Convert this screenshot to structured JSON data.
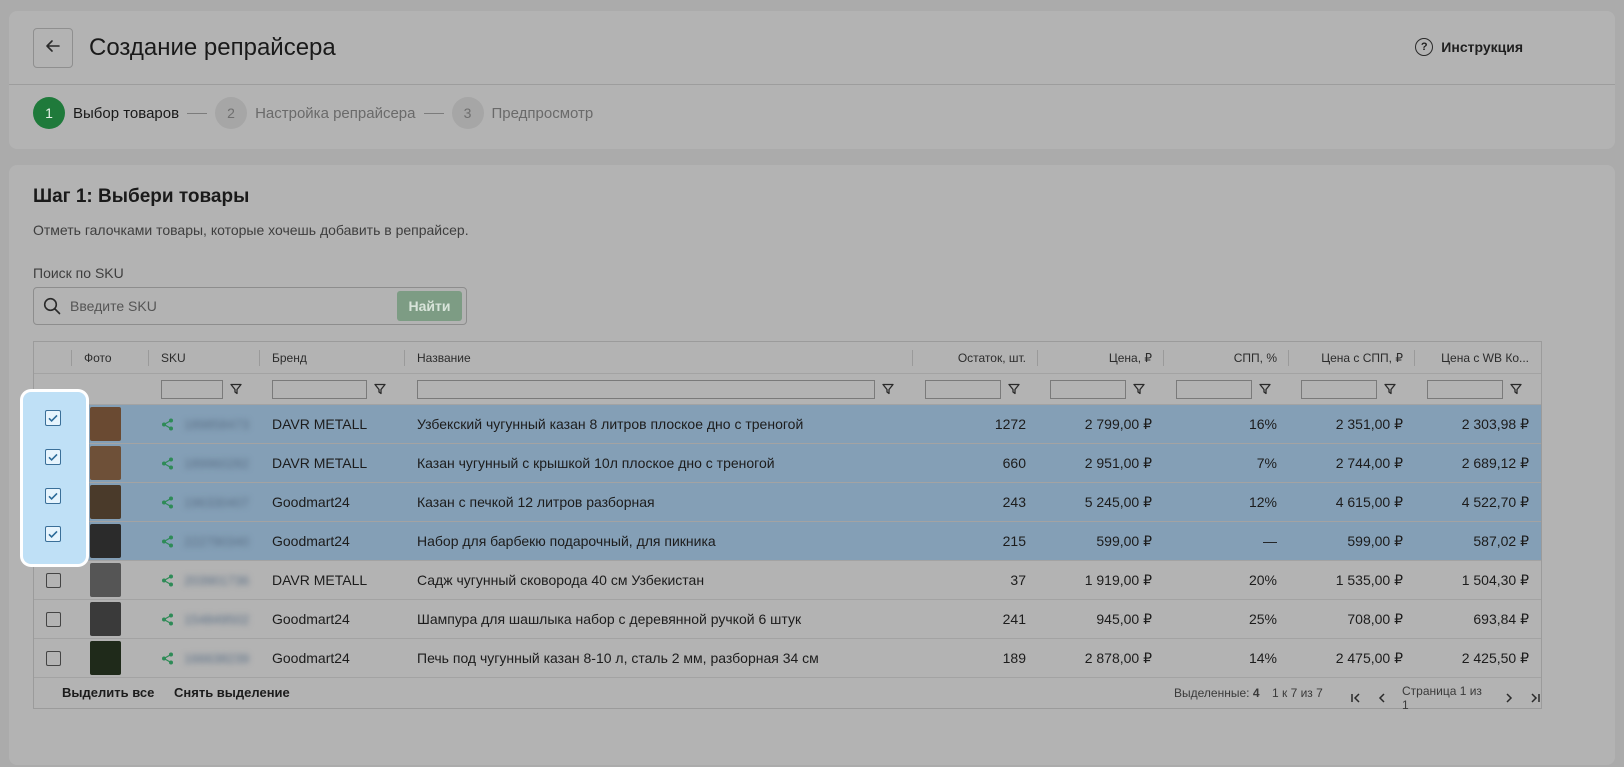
{
  "header": {
    "title": "Создание репрайсера",
    "instruction_label": "Инструкция",
    "instruction_icon": "?"
  },
  "steps": [
    {
      "num": "1",
      "label": "Выбор товаров"
    },
    {
      "num": "2",
      "label": "Настройка репрайсера"
    },
    {
      "num": "3",
      "label": "Предпросмотр"
    }
  ],
  "main": {
    "step_title": "Шаг 1: Выбери товары",
    "step_desc": "Отметь галочками товары, которые хочешь добавить в репрайсер.",
    "search_label": "Поиск по SKU",
    "search_placeholder": "Введите SKU",
    "find_label": "Найти"
  },
  "table": {
    "columns": {
      "photo": "Фото",
      "sku": "SKU",
      "brand": "Бренд",
      "name": "Название",
      "stock": "Остаток, шт.",
      "price": "Цена, ₽",
      "spp": "СПП, %",
      "price_spp": "Цена с СПП, ₽",
      "price_wb": "Цена с WB Ко..."
    },
    "rows": [
      {
        "sku": "189858473",
        "brand": "DAVR METALL",
        "name": "Узбекский чугунный казан 8 литров плоское дно с треногой",
        "stock": "1272",
        "price": "2 799,00 ₽",
        "spp": "16%",
        "price_spp": "2 351,00 ₽",
        "price_wb": "2 303,98 ₽",
        "selected": true
      },
      {
        "sku": "189960282",
        "brand": "DAVR METALL",
        "name": "Казан чугунный с крышкой 10л плоское дно с треногой",
        "stock": "660",
        "price": "2 951,00 ₽",
        "spp": "7%",
        "price_spp": "2 744,00 ₽",
        "price_wb": "2 689,12 ₽",
        "selected": true
      },
      {
        "sku": "196330407",
        "brand": "Goodmart24",
        "name": "Казан с печкой 12 литров разборная",
        "stock": "243",
        "price": "5 245,00 ₽",
        "spp": "12%",
        "price_spp": "4 615,00 ₽",
        "price_wb": "4 522,70 ₽",
        "selected": true
      },
      {
        "sku": "222790340",
        "brand": "Goodmart24",
        "name": "Набор для барбекю подарочный, для пикника",
        "stock": "215",
        "price": "599,00 ₽",
        "spp": "—",
        "price_spp": "599,00 ₽",
        "price_wb": "587,02 ₽",
        "selected": true
      },
      {
        "sku": "203901736",
        "brand": "DAVR METALL",
        "name": "Садж чугунный сковорода 40 см Узбекистан",
        "stock": "37",
        "price": "1 919,00 ₽",
        "spp": "20%",
        "price_spp": "1 535,00 ₽",
        "price_wb": "1 504,30 ₽",
        "selected": false
      },
      {
        "sku": "154849502",
        "brand": "Goodmart24",
        "name": "Шампура для шашлыка набор с деревянной ручкой 6 штук",
        "stock": "241",
        "price": "945,00 ₽",
        "spp": "25%",
        "price_spp": "708,00 ₽",
        "price_wb": "693,84 ₽",
        "selected": false
      },
      {
        "sku": "166638239",
        "brand": "Goodmart24",
        "name": "Печь под чугунный казан 8-10 л, сталь 2 мм, разборная 34 см",
        "stock": "189",
        "price": "2 878,00 ₽",
        "spp": "14%",
        "price_spp": "2 475,00 ₽",
        "price_wb": "2 425,50 ₽",
        "selected": false
      }
    ],
    "footer": {
      "select_all": "Выделить все",
      "deselect": "Снять выделение",
      "selected_label": "Выделенные:",
      "selected_count": "4",
      "range": "1 к 7 из 7",
      "page_text": "Страница 1 из 1"
    }
  },
  "colors": {
    "accent_green": "#1f7a3b",
    "selected_row": "#849fb6",
    "share_icon": "#2e8b57"
  }
}
